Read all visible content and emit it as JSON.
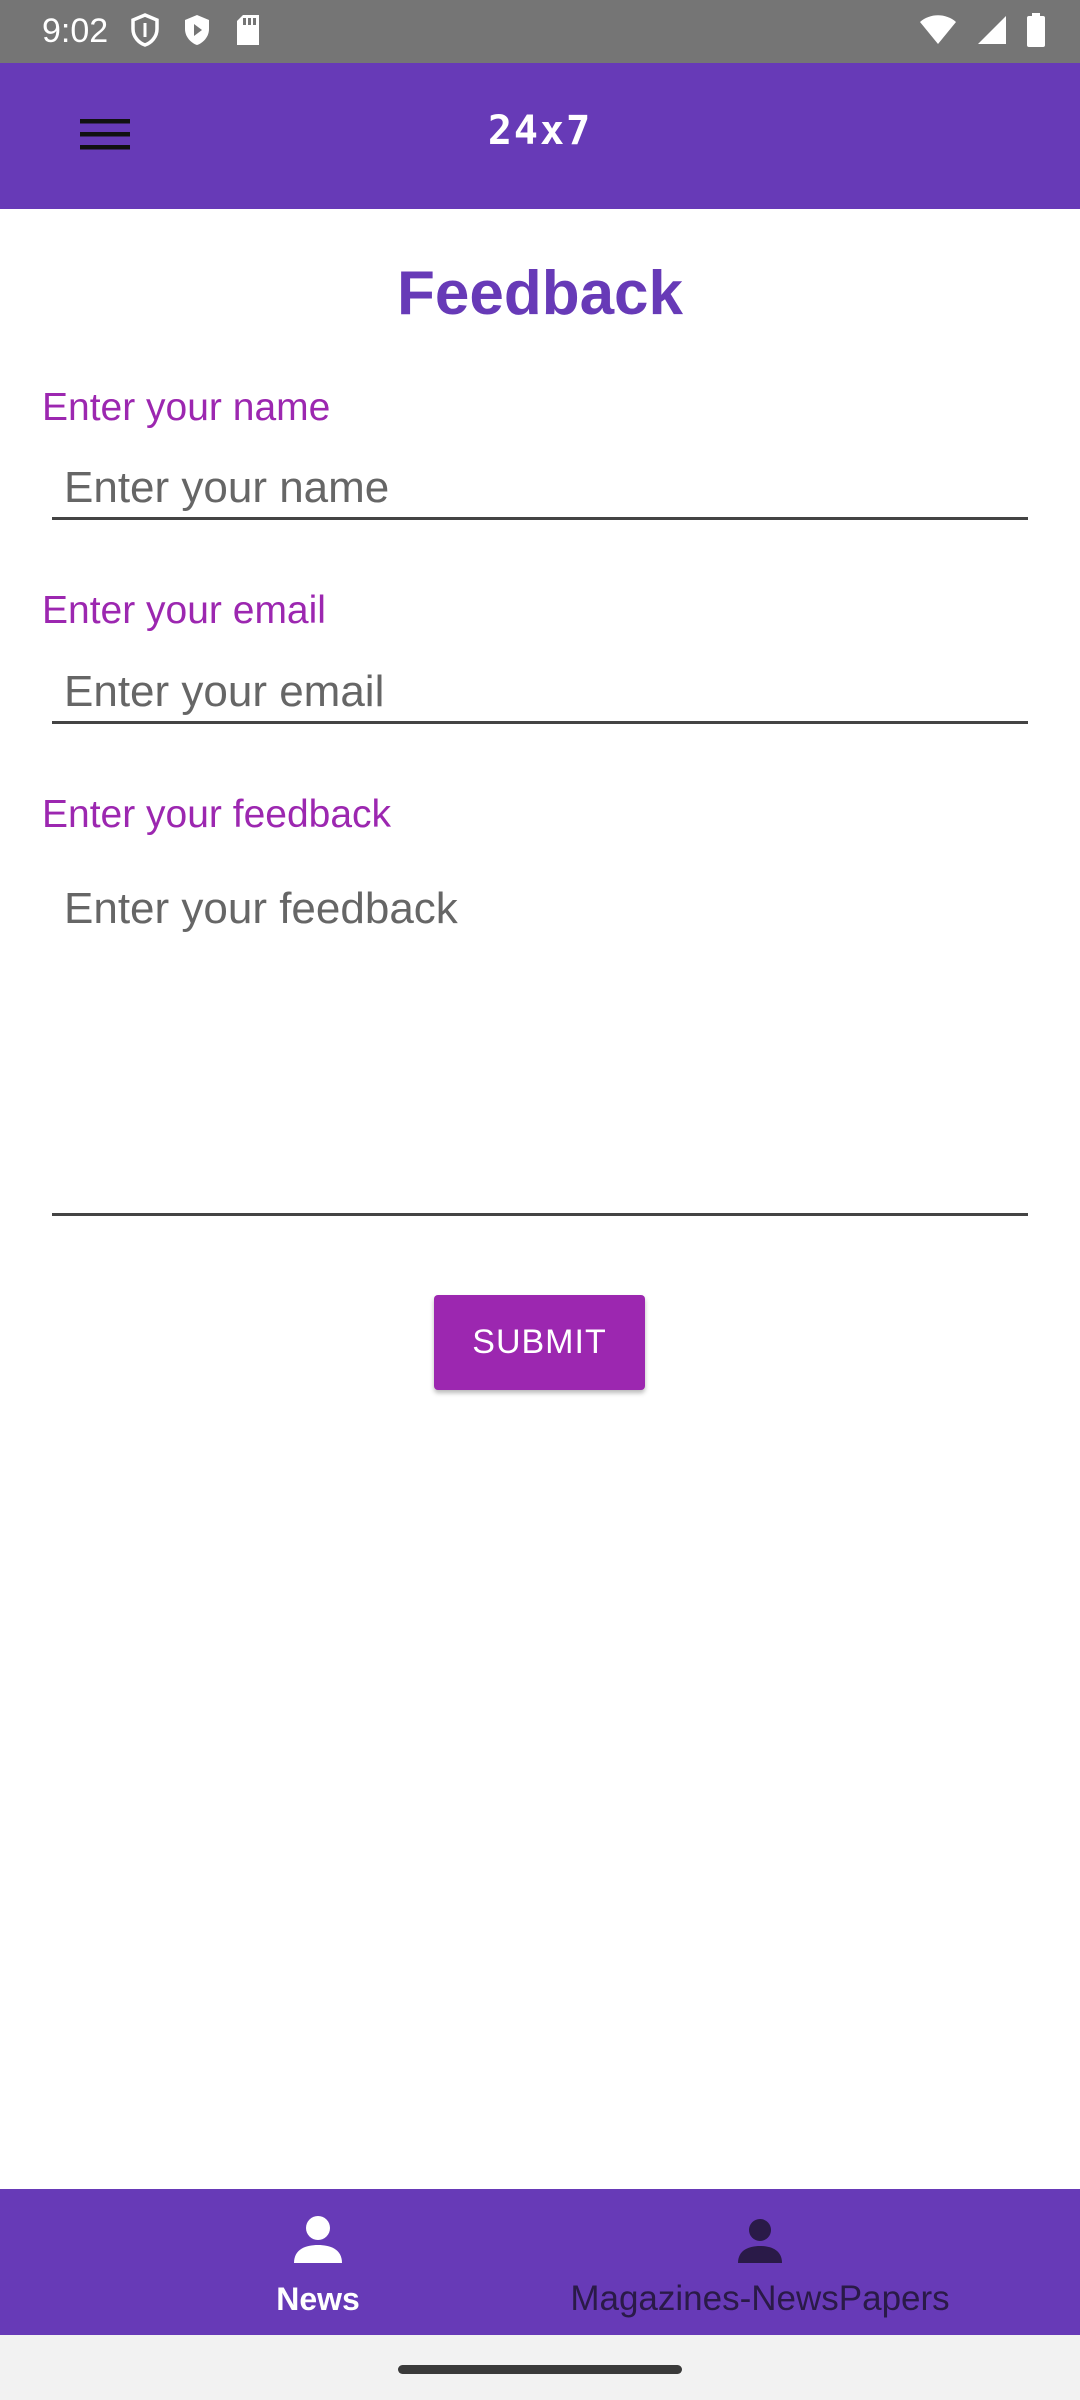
{
  "status_bar": {
    "time": "9:02",
    "icons": [
      "shield-icon",
      "play-protect-icon",
      "sd-card-icon",
      "wifi-icon",
      "signal-icon",
      "battery-icon"
    ]
  },
  "app_bar": {
    "title": "24x7",
    "menu_icon": "hamburger-menu-icon",
    "background": "#673ab7"
  },
  "feedback": {
    "title": "Feedback",
    "name": {
      "label": "Enter your name",
      "placeholder": "Enter your name",
      "value": ""
    },
    "email": {
      "label": "Enter your email",
      "placeholder": "Enter your email",
      "value": ""
    },
    "message": {
      "label": "Enter your feedback",
      "placeholder": "Enter your feedback",
      "value": ""
    },
    "submit_label": "SUBMIT"
  },
  "bottom_nav": {
    "items": [
      {
        "label": "News",
        "icon": "person-icon",
        "selected": true
      },
      {
        "label": "Magazines-NewsPapers",
        "icon": "person-icon",
        "selected": false
      }
    ]
  },
  "colors": {
    "primary": "#673ab7",
    "accent": "#9c27b0",
    "status_bar": "#757575"
  }
}
